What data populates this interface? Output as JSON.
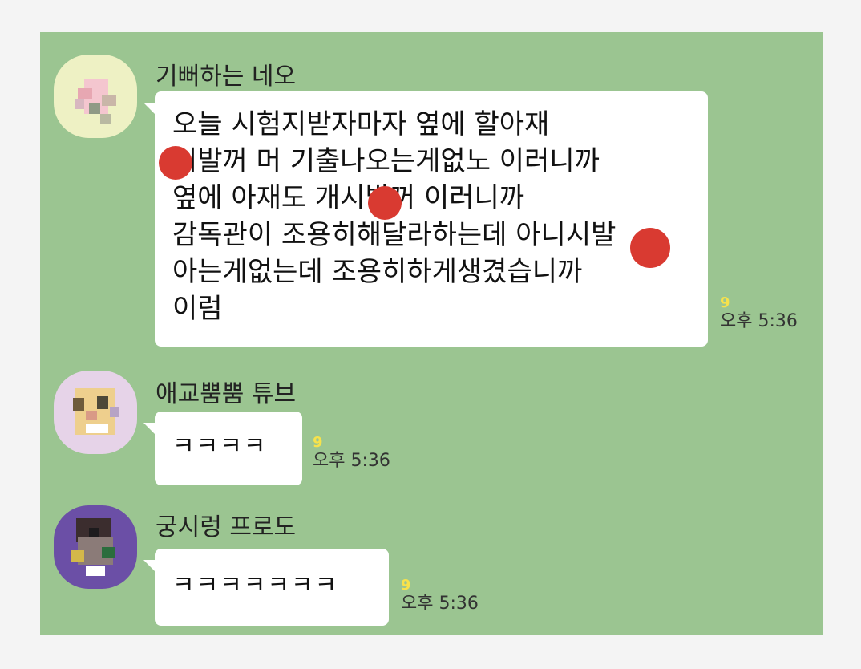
{
  "messages": [
    {
      "sender": "기뻐하는 네오",
      "lines": [
        "오늘 시험지받자마자 옆에 할아재",
        "시발꺼 머 기출나오는게없노 이러니까",
        "옆에 아재도 개시발꺼 이러니까",
        "감독관이 조용히해달라하는데 아니시발",
        "아는게없는데 조용히하게생겼습니까",
        "이럼"
      ],
      "unread": "9",
      "time": "오후 5:36",
      "avatar_icon": "neo-avatar-icon"
    },
    {
      "sender": "애교뿜뿜 튜브",
      "lines": [
        "ㅋㅋㅋㅋ"
      ],
      "unread": "9",
      "time": "오후 5:36",
      "avatar_icon": "tube-avatar-icon"
    },
    {
      "sender": "궁시렁 프로도",
      "lines": [
        "ㅋㅋㅋㅋㅋㅋㅋ"
      ],
      "unread": "9",
      "time": "오후 5:36",
      "avatar_icon": "frodo-avatar-icon"
    }
  ],
  "colors": {
    "chat_background": "#9bc591",
    "bubble": "#ffffff",
    "unread_count": "#f7e24b",
    "redaction": "#d93a31"
  }
}
